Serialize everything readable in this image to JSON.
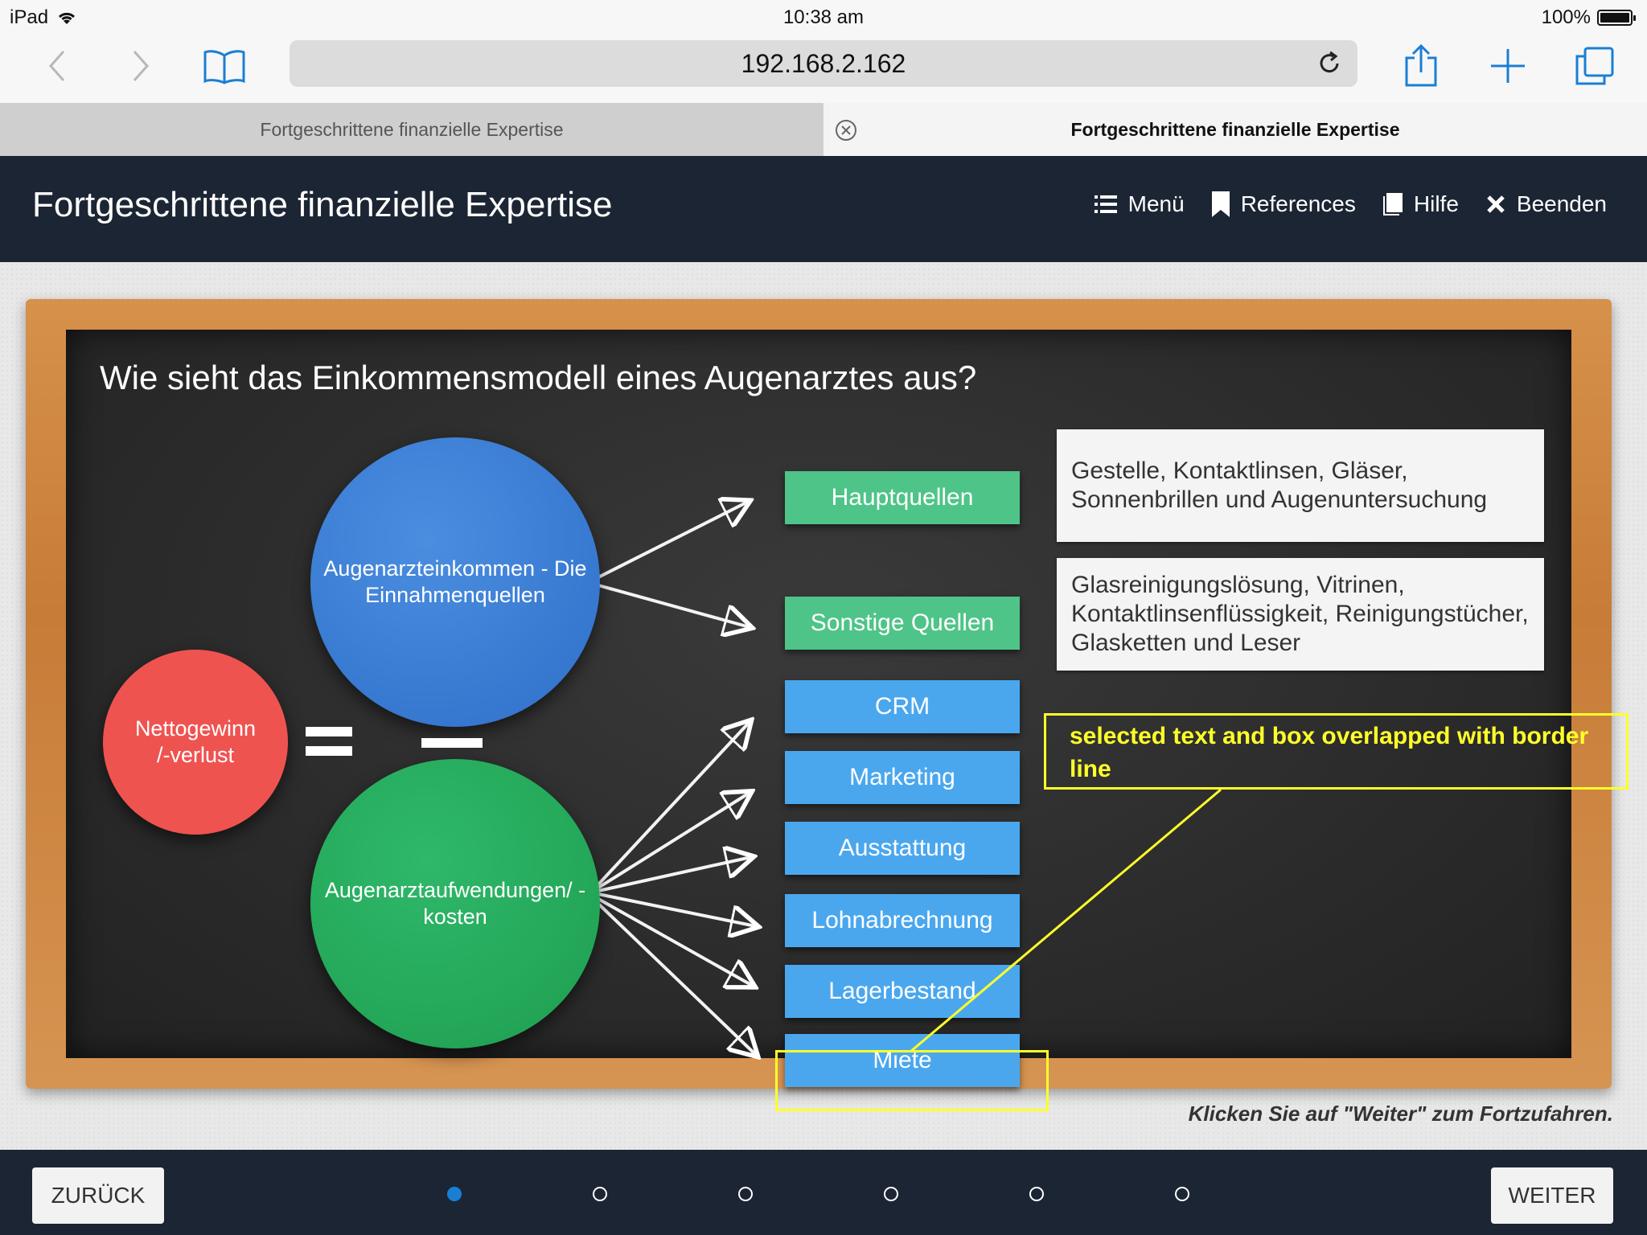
{
  "status": {
    "device": "iPad",
    "time": "10:38 am",
    "battery": "100%"
  },
  "browser": {
    "url": "192.168.2.162",
    "tabs": [
      {
        "label": "Fortgeschrittene finanzielle Expertise"
      },
      {
        "label": "Fortgeschrittene finanzielle Expertise"
      }
    ]
  },
  "app": {
    "title": "Fortgeschrittene finanzielle Expertise",
    "nav": {
      "menu": "Menü",
      "references": "References",
      "help": "Hilfe",
      "exit": "Beenden"
    }
  },
  "slide": {
    "question": "Wie sieht das Einkommensmodell eines Augenarztes aus?",
    "net": "Nettogewinn /-verlust",
    "income": "Augenarzteinkommen - Die Einnahmenquellen",
    "costs": "Augenarztaufwendungen/ -kosten",
    "income_boxes": [
      "Hauptquellen",
      "Sonstige Quellen"
    ],
    "cost_boxes": [
      "CRM",
      "Marketing",
      "Ausstattung",
      "Lohnabrechnung",
      "Lagerbestand",
      "Miete"
    ],
    "descriptions": [
      "Gestelle, Kontaktlinsen, Gläser, Sonnenbrillen und Augenuntersuchung",
      "Glasreinigungslösung, Vitrinen, Kontaktlinsenflüssigkeit, Reinigungstücher, Glasketten und Leser"
    ],
    "hint": "Klicken Sie auf \"Weiter\" zum Fortzufahren."
  },
  "annotation": {
    "text": "selected text and box overlapped with border line",
    "color": "#ffff2a"
  },
  "footer": {
    "back": "ZURÜCK",
    "next": "WEITER",
    "pages": 6,
    "current_page": 1
  },
  "colors": {
    "header": "#1c2533",
    "net": "#ef5350",
    "income": "#2f6fc9",
    "costs": "#1e9e50",
    "green_box": "#4fc488",
    "blue_box": "#4aa7ee",
    "dot_active": "#1a7fd4"
  }
}
